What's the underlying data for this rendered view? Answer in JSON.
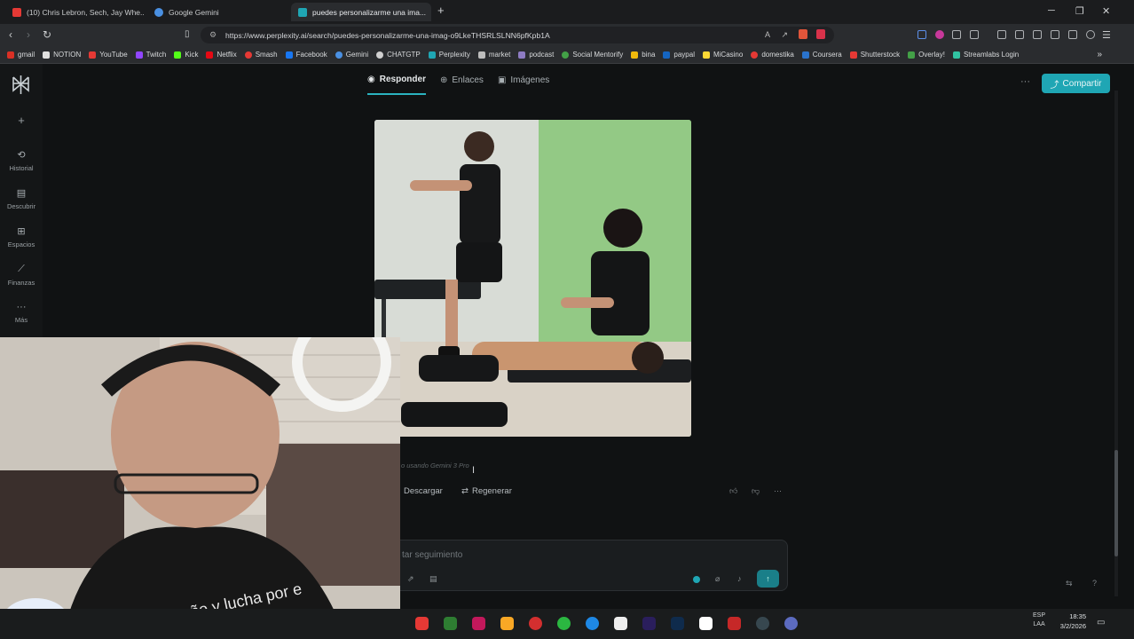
{
  "browser": {
    "tabs": [
      {
        "label": "(10) Chris Lebron, Sech, Jay Whe...",
        "active": false
      },
      {
        "label": "Google Gemini",
        "active": false
      },
      {
        "label": "puedes personalizarme una ima...",
        "active": true
      }
    ],
    "new_tab": "+",
    "window_controls": {
      "minimize": "─",
      "maximize": "❐",
      "close": "✕"
    },
    "url": "https://www.perplexity.ai/search/puedes-personalizarme-una-imag-o9LkeTHSRLSLNN6pfKpb1A",
    "bookmarks": [
      {
        "label": "gmail",
        "color": "#d93025"
      },
      {
        "label": "NOTION",
        "color": "#e0e0e0"
      },
      {
        "label": "YouTube",
        "color": "#e53935"
      },
      {
        "label": "Twitch",
        "color": "#9146ff"
      },
      {
        "label": "Kick",
        "color": "#53fc18"
      },
      {
        "label": "Netflix",
        "color": "#e50914"
      },
      {
        "label": "Smash",
        "color": "#e53935"
      },
      {
        "label": "Facebook",
        "color": "#1877f2"
      },
      {
        "label": "Gemini",
        "color": "#4a90e2"
      },
      {
        "label": "CHATGTP",
        "color": "#d0d0d0"
      },
      {
        "label": "Perplexity",
        "color": "#1fa6b4"
      },
      {
        "label": "market",
        "color": "#bdbdbd"
      },
      {
        "label": "podcast",
        "color": "#8e7cc3"
      },
      {
        "label": "Social Mentorify",
        "color": "#43a047"
      },
      {
        "label": "bina",
        "color": "#f0b90b"
      },
      {
        "label": "paypal",
        "color": "#1565c0"
      },
      {
        "label": "MiCasino",
        "color": "#fdd835"
      },
      {
        "label": "domestika",
        "color": "#e53935"
      },
      {
        "label": "Coursera",
        "color": "#2a73cc"
      },
      {
        "label": "Shutterstock",
        "color": "#e53935"
      },
      {
        "label": "Overlay!",
        "color": "#43a047"
      },
      {
        "label": "Streamlabs Login",
        "color": "#31c3a2"
      }
    ],
    "more_bookmarks": "»"
  },
  "sidebar": {
    "new": "+",
    "items": [
      {
        "label": "Historial",
        "icon": "history-icon"
      },
      {
        "label": "Descubrir",
        "icon": "discover-icon"
      },
      {
        "label": "Espacios",
        "icon": "spaces-icon"
      },
      {
        "label": "Finanzas",
        "icon": "finance-icon"
      },
      {
        "label": "Más",
        "icon": "more-icon"
      }
    ]
  },
  "content": {
    "tabs": [
      {
        "label": "Responder",
        "active": true
      },
      {
        "label": "Enlaces",
        "active": false
      },
      {
        "label": "Imágenes",
        "active": false
      }
    ],
    "more": "···",
    "share_label": "Compartir",
    "caption": "o usando Gemini 3 Pro",
    "download_label": "Descargar",
    "regenerate_label": "Regenerar",
    "followup_placeholder": "tar seguimiento",
    "accent": "#1fa6b4"
  },
  "webcam": {
    "shirt_text": "ve tu sueño y lucha por e"
  },
  "taskbar": {
    "lang": "ESP",
    "lang2": "LAA",
    "time": "18:35",
    "date": "3/2/2026"
  }
}
